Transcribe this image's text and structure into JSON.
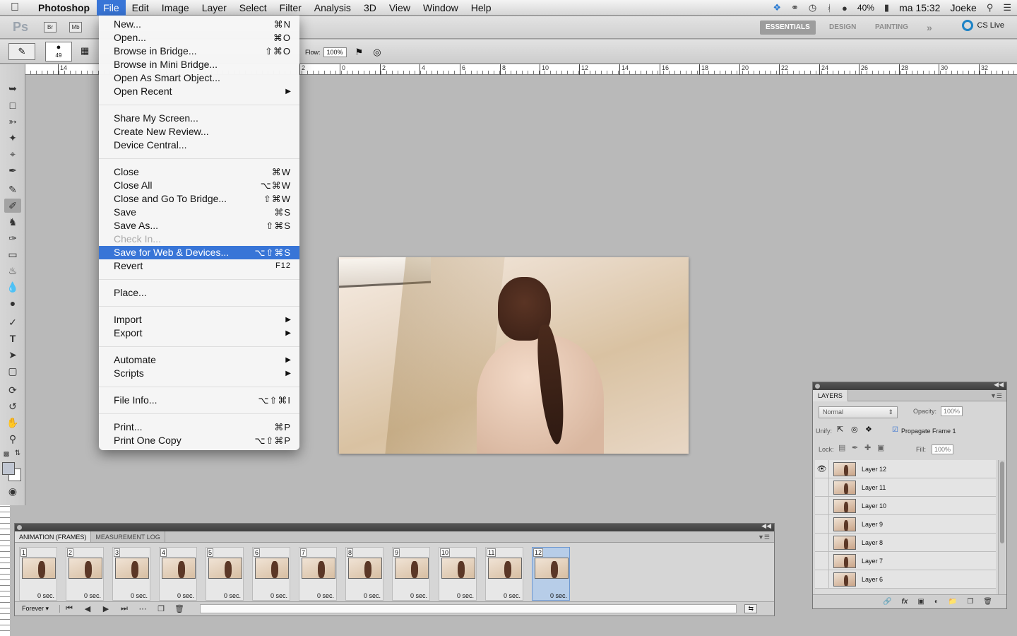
{
  "menubar": {
    "app_name": "Photoshop",
    "items": [
      "File",
      "Edit",
      "Image",
      "Layer",
      "Select",
      "Filter",
      "Analysis",
      "3D",
      "View",
      "Window",
      "Help"
    ],
    "battery": "40%",
    "clock": "ma 15:32",
    "user": "Joeke"
  },
  "appbar": {
    "logo": "Ps",
    "bridge": "Br",
    "minibridge": "Mb",
    "workspaces": [
      "ESSENTIALS",
      "DESIGN",
      "PAINTING"
    ],
    "more": "»",
    "cslive": "CS Live"
  },
  "options": {
    "brush_size": "49",
    "flow_label": "Flow:",
    "flow_value": "100%"
  },
  "ruler": {
    "ticks": [
      "14",
      "2",
      "0",
      "2",
      "4",
      "6",
      "8",
      "10",
      "12",
      "14",
      "16",
      "18",
      "20",
      "22",
      "24",
      "26",
      "28",
      "30",
      "32"
    ]
  },
  "file_menu": {
    "items": [
      {
        "label": "New...",
        "shortcut": "⌘N"
      },
      {
        "label": "Open...",
        "shortcut": "⌘O"
      },
      {
        "label": "Browse in Bridge...",
        "shortcut": "⇧⌘O"
      },
      {
        "label": "Browse in Mini Bridge...",
        "shortcut": ""
      },
      {
        "label": "Open As Smart Object...",
        "shortcut": ""
      },
      {
        "label": "Open Recent",
        "shortcut": "",
        "submenu": true
      },
      {
        "separator": true
      },
      {
        "label": "Share My Screen...",
        "shortcut": ""
      },
      {
        "label": "Create New Review...",
        "shortcut": ""
      },
      {
        "label": "Device Central...",
        "shortcut": ""
      },
      {
        "separator": true
      },
      {
        "label": "Close",
        "shortcut": "⌘W"
      },
      {
        "label": "Close All",
        "shortcut": "⌥⌘W"
      },
      {
        "label": "Close and Go To Bridge...",
        "shortcut": "⇧⌘W"
      },
      {
        "label": "Save",
        "shortcut": "⌘S"
      },
      {
        "label": "Save As...",
        "shortcut": "⇧⌘S"
      },
      {
        "label": "Check In...",
        "shortcut": "",
        "disabled": true
      },
      {
        "label": "Save for Web & Devices...",
        "shortcut": "⌥⇧⌘S",
        "highlighted": true
      },
      {
        "label": "Revert",
        "shortcut": "F12"
      },
      {
        "separator": true
      },
      {
        "label": "Place...",
        "shortcut": ""
      },
      {
        "separator": true
      },
      {
        "label": "Import",
        "shortcut": "",
        "submenu": true
      },
      {
        "label": "Export",
        "shortcut": "",
        "submenu": true
      },
      {
        "separator": true
      },
      {
        "label": "Automate",
        "shortcut": "",
        "submenu": true
      },
      {
        "label": "Scripts",
        "shortcut": "",
        "submenu": true
      },
      {
        "separator": true
      },
      {
        "label": "File Info...",
        "shortcut": "⌥⇧⌘I"
      },
      {
        "separator": true
      },
      {
        "label": "Print...",
        "shortcut": "⌘P"
      },
      {
        "label": "Print One Copy",
        "shortcut": "⌥⇧⌘P"
      }
    ]
  },
  "animation_panel": {
    "tabs": [
      "ANIMATION (FRAMES)",
      "MEASUREMENT LOG"
    ],
    "frames": [
      {
        "num": "1",
        "delay": "0 sec."
      },
      {
        "num": "2",
        "delay": "0 sec."
      },
      {
        "num": "3",
        "delay": "0 sec."
      },
      {
        "num": "4",
        "delay": "0 sec."
      },
      {
        "num": "5",
        "delay": "0 sec."
      },
      {
        "num": "6",
        "delay": "0 sec."
      },
      {
        "num": "7",
        "delay": "0 sec."
      },
      {
        "num": "8",
        "delay": "0 sec."
      },
      {
        "num": "9",
        "delay": "0 sec."
      },
      {
        "num": "10",
        "delay": "0 sec."
      },
      {
        "num": "11",
        "delay": "0 sec."
      },
      {
        "num": "12",
        "delay": "0 sec."
      }
    ],
    "selected_frame": "12",
    "loop": "Forever"
  },
  "layers_panel": {
    "tab": "LAYERS",
    "blend_mode": "Normal",
    "opacity_label": "Opacity:",
    "opacity_value": "100%",
    "unify_label": "Unify:",
    "propagate_label": "Propagate Frame 1",
    "lock_label": "Lock:",
    "fill_label": "Fill:",
    "fill_value": "100%",
    "layers": [
      {
        "name": "Layer 12",
        "visible": true
      },
      {
        "name": "Layer 11",
        "visible": false
      },
      {
        "name": "Layer 10",
        "visible": false
      },
      {
        "name": "Layer 9",
        "visible": false
      },
      {
        "name": "Layer 8",
        "visible": false
      },
      {
        "name": "Layer 7",
        "visible": false
      },
      {
        "name": "Layer 6",
        "visible": false
      }
    ]
  },
  "colors": {
    "menu_highlight": "#3875d7",
    "panel_bg": "#d6d6d6",
    "workspace_bg": "#b9b9b9"
  }
}
